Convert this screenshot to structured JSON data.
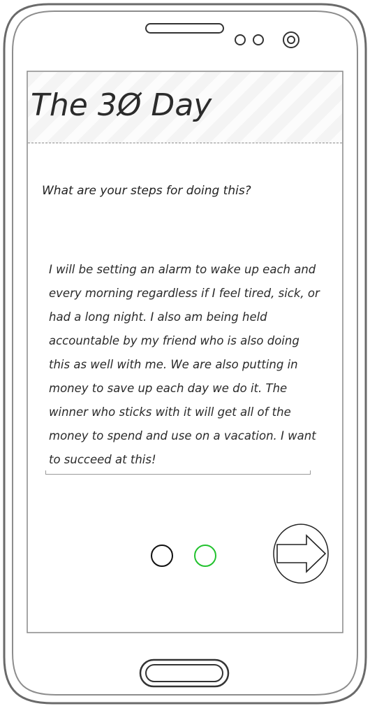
{
  "app": {
    "title": "The 3Ø Day"
  },
  "question": {
    "text": "What are your steps for doing this?"
  },
  "answer": {
    "text": "I will be setting an alarm to wake up each and every morning regardless if I feel tired, sick, or had a long night. I also am being held accountable by my friend who is also doing this as well with me. We are also putting in money to save up each day we do it. The winner who sticks with it will get all of the money to spend and use on a vacation. I want to succeed at this!"
  },
  "pagination": {
    "total_pages": 2,
    "current_page": 2,
    "inactive_color": "#111111",
    "active_color": "#22c22e"
  },
  "next_button": {
    "icon": "arrow-right-icon"
  }
}
